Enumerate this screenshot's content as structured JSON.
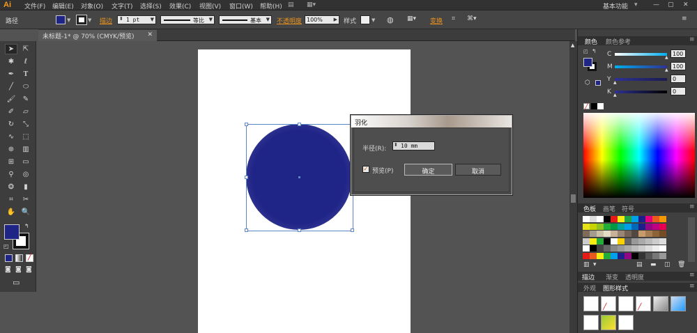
{
  "app": {
    "logo": "Ai",
    "workspace": "基本功能"
  },
  "menu": [
    "文件(F)",
    "编辑(E)",
    "对象(O)",
    "文字(T)",
    "选择(S)",
    "效果(C)",
    "视图(V)",
    "窗口(W)",
    "帮助(H)"
  ],
  "control": {
    "path_label": "路径",
    "stroke_label": "描边",
    "stroke_weight": "1 pt",
    "profile": "等比",
    "brush": "基本",
    "opacity_label": "不透明度",
    "opacity_value": "100%",
    "style_label": "样式",
    "transform_label": "变换"
  },
  "document": {
    "tab_title": "未标题-1* @ 70% (CMYK/预览)"
  },
  "colors": {
    "fill": "#1f2487",
    "accent": "#e8921e",
    "selection": "#5a86c9"
  },
  "feather_dialog": {
    "title": "羽化",
    "radius_label": "半径(R):",
    "radius_value": "10 mm",
    "preview_label": "预览(P)",
    "preview_checked": true,
    "ok_label": "确定",
    "cancel_label": "取消"
  },
  "color_panel": {
    "tab_color": "颜色",
    "tab_color_guide": "颜色参考",
    "channels": [
      {
        "name": "C",
        "value": "100"
      },
      {
        "name": "M",
        "value": "100"
      },
      {
        "name": "Y",
        "value": "0"
      },
      {
        "name": "K",
        "value": "0"
      }
    ]
  },
  "swatches_panel": {
    "tab_swatches": "色板",
    "tab_brushes": "画笔",
    "tab_symbols": "符号"
  },
  "stroke_panel": {
    "tab_stroke": "描边",
    "tab_gradient": "渐变",
    "tab_transparency": "透明度"
  },
  "appearance_panel": {
    "tab_appearance": "外观",
    "tab_graphic_styles": "图形样式"
  }
}
